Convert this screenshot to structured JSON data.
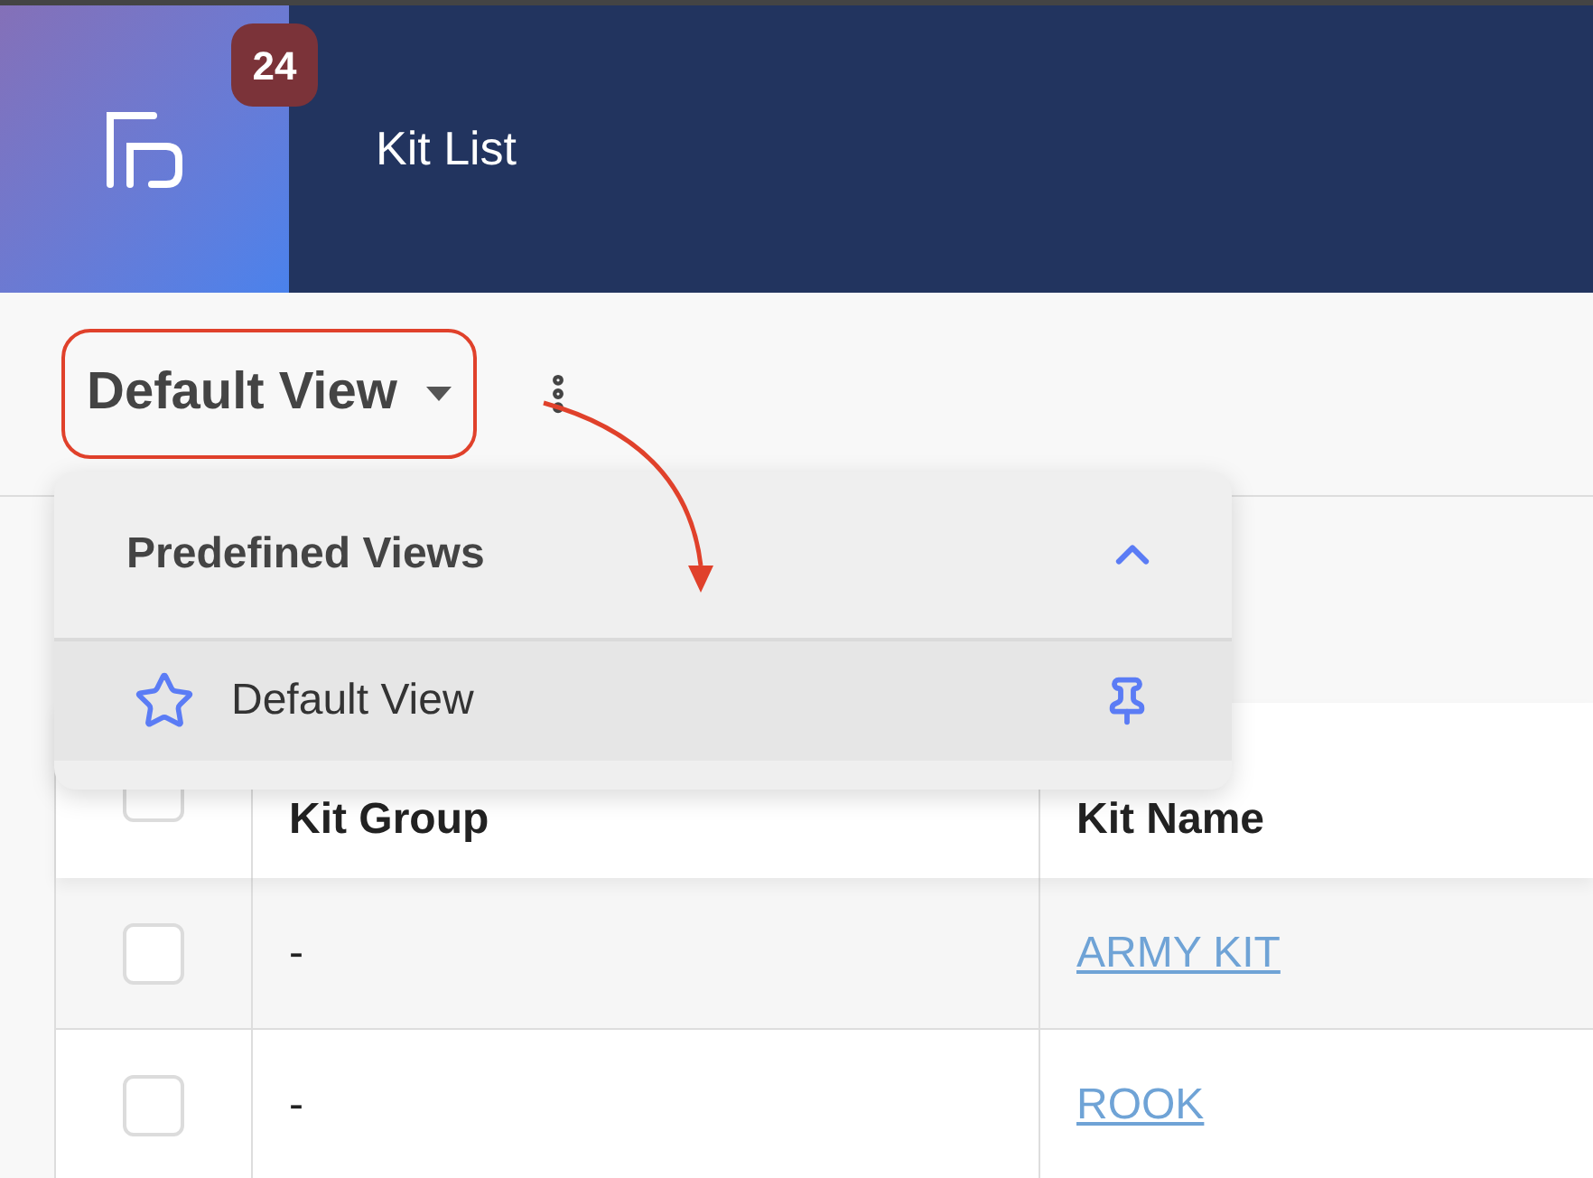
{
  "header": {
    "badge": "24",
    "title": "Kit List"
  },
  "view_selector": {
    "label": "Default View"
  },
  "dropdown": {
    "section_title": "Predefined Views",
    "expanded": true,
    "items": [
      {
        "label": "Default View",
        "pinned": true
      }
    ]
  },
  "table": {
    "header_checked": false,
    "columns": [
      "Kit Group",
      "Kit Name"
    ],
    "rows": [
      {
        "checked": false,
        "kit_group": "-",
        "kit_name": "ARMY KIT"
      },
      {
        "checked": false,
        "kit_group": "-",
        "kit_name": "ROOK"
      }
    ]
  }
}
